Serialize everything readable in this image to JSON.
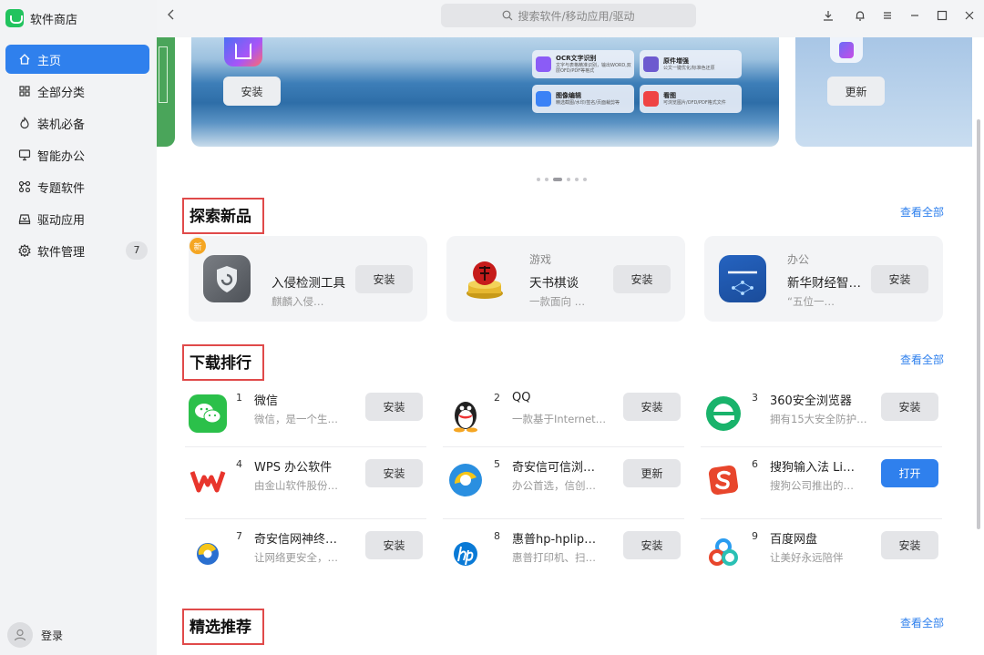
{
  "app": {
    "title": "软件商店"
  },
  "sidebar": {
    "items": [
      {
        "label": "主页",
        "icon": "home-icon",
        "active": true
      },
      {
        "label": "全部分类",
        "icon": "grid-icon"
      },
      {
        "label": "装机必备",
        "icon": "flame-icon"
      },
      {
        "label": "智能办公",
        "icon": "monitor-icon"
      },
      {
        "label": "专题软件",
        "icon": "topic-icon"
      },
      {
        "label": "驱动应用",
        "icon": "driver-icon"
      },
      {
        "label": "软件管理",
        "icon": "gear-icon",
        "badge": "7"
      }
    ],
    "login_label": "登录"
  },
  "topbar": {
    "search_placeholder": "搜索软件/移动应用/驱动"
  },
  "banner": {
    "left_button": "安装",
    "right_button": "更新",
    "features": [
      {
        "title": "OCR文字识别",
        "sub": "文字与表格精准识别，输出WORD,双层OFD/PDF等格式",
        "color": "#8b5cf6"
      },
      {
        "title": "原件增强",
        "sub": "公文一键优化/标准色还原",
        "color": "#6d5acf"
      },
      {
        "title": "图像编辑",
        "sub": "精选截图/水印/签名/页面裁剪等",
        "color": "#3b82f6"
      },
      {
        "title": "看图",
        "sub": "可浏览图片/OFD/PDF格式文件",
        "color": "#ef4444"
      }
    ],
    "page_count": 6,
    "active_page": 2
  },
  "sections": {
    "explore": {
      "title": "探索新品",
      "see_all": "查看全部"
    },
    "ranking": {
      "title": "下载排行",
      "see_all": "查看全部"
    },
    "featured": {
      "title": "精选推荐",
      "see_all": "查看全部"
    }
  },
  "new_apps": [
    {
      "category": "",
      "name": "入侵检测工具",
      "desc": "麒麟入侵…",
      "button": "安装",
      "badge": "新",
      "icon": "shield-icon",
      "color": "#666a70"
    },
    {
      "category": "游戏",
      "name": "天书棋谈",
      "desc": "一款面向 …",
      "button": "安装",
      "icon": "chess-icon",
      "color": "#c8a020"
    },
    {
      "category": "办公",
      "name": "新华财经智…",
      "desc": "“五位一…",
      "button": "安装",
      "icon": "xinhua-finance-icon",
      "color": "#1f5fb5"
    }
  ],
  "ranking": [
    {
      "rank": "1",
      "name": "微信",
      "desc": "微信，是一个生…",
      "button": "安装",
      "icon": "wechat-icon",
      "color": "#2bc04a"
    },
    {
      "rank": "2",
      "name": "QQ",
      "desc": "一款基于Internet…",
      "button": "安装",
      "icon": "qq-icon",
      "color": "#222222"
    },
    {
      "rank": "3",
      "name": "360安全浏览器",
      "desc": "拥有15大安全防护…",
      "button": "安装",
      "icon": "browser-360-icon",
      "color": "#19b36b"
    },
    {
      "rank": "4",
      "name": "WPS 办公软件",
      "desc": "由金山软件股份…",
      "button": "安装",
      "icon": "wps-icon",
      "color": "#e8352c"
    },
    {
      "rank": "5",
      "name": "奇安信可信浏…",
      "desc": "办公首选，信创…",
      "button": "更新",
      "icon": "qianxin-browser-icon",
      "color": "#2a8fe0"
    },
    {
      "rank": "6",
      "name": "搜狗输入法 Li…",
      "desc": "搜狗公司推出的…",
      "button": "打开",
      "primary": true,
      "icon": "sogou-icon",
      "color": "#e8462c"
    },
    {
      "rank": "7",
      "name": "奇安信网神终…",
      "desc": "让网络更安全，…",
      "button": "安装",
      "icon": "qianxin-terminal-icon",
      "color": "#2a6fd0"
    },
    {
      "rank": "8",
      "name": "惠普hp-hplip…",
      "desc": "惠普打印机、扫…",
      "button": "安装",
      "icon": "hp-icon",
      "color": "#0a7ad6"
    },
    {
      "rank": "9",
      "name": "百度网盘",
      "desc": "让美好永远陪伴",
      "button": "安装",
      "icon": "baidu-netdisk-icon",
      "color": "#2a9cf0"
    }
  ]
}
